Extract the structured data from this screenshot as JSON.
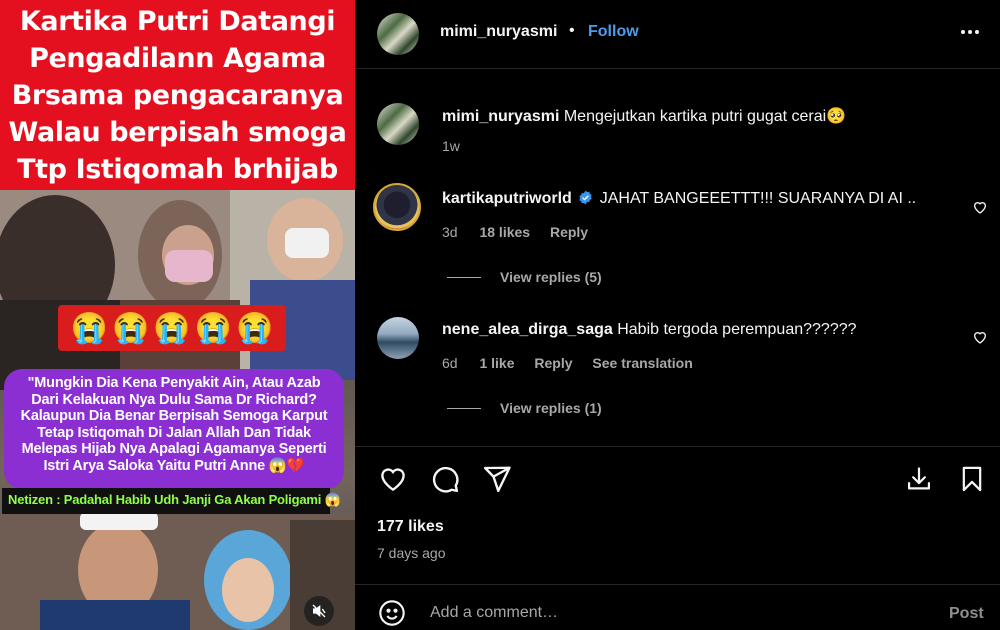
{
  "media": {
    "headline_lines": [
      "Kartika Putri Datangi",
      "Pengadilann Agama",
      "Brsama pengacaranya",
      "Walau berpisah smoga",
      "Ttp Istiqomah brhijab"
    ],
    "emoji_strip": [
      "😭",
      "😭",
      "😭",
      "😭",
      "😭"
    ],
    "quote_lines": [
      "\"Mungkin Dia Kena Penyakit Ain, Atau Azab",
      "Dari Kelakuan Nya Dulu Sama Dr Richard?",
      "Kalaupun Dia Benar Berpisah Semoga Karput",
      "Tetap Istiqomah Di Jalan Allah Dan Tidak",
      "Melepas Hijab Nya Apalagi Agamanya Seperti",
      "Istri Arya Saloka Yaitu Putri Anne 😱💔"
    ],
    "netizen_caption": "Netizen : Padahal Habib Udh Janji Ga Akan Poligami 😱",
    "mute_icon": "speaker-muted-icon"
  },
  "post": {
    "author": "mimi_nuryasmi",
    "separator": "•",
    "follow_label": "Follow",
    "more_icon": "more-horizontal-icon",
    "caption": {
      "user": "mimi_nuryasmi",
      "text": "Mengejutkan kartika putri gugat cerai🥺",
      "time": "1w"
    },
    "comments": [
      {
        "user": "kartikaputriworld",
        "verified": true,
        "text": "JAHAT BANGEEETTT!!! SUARANYA DI AI ..",
        "time": "3d",
        "likes": "18 likes",
        "reply": "Reply",
        "view_replies": "View replies (5)"
      },
      {
        "user": "nene_alea_dirga_saga",
        "verified": false,
        "text": "Habib tergoda perempuan??????",
        "time": "6d",
        "likes": "1 like",
        "reply": "Reply",
        "translation": "See translation",
        "view_replies": "View replies (1)"
      }
    ],
    "likes_count": "177 likes",
    "posted_ago": "7 days ago",
    "add_comment_placeholder": "Add a comment…",
    "post_button": "Post"
  },
  "colors": {
    "background": "#000000",
    "text_primary": "#f5f5f5",
    "text_secondary": "#a8a8a8",
    "link_blue": "#4b9dec",
    "headline_red": "#e4101f",
    "quote_purple": "#8b2fd3",
    "verified_blue": "#3897f0"
  }
}
